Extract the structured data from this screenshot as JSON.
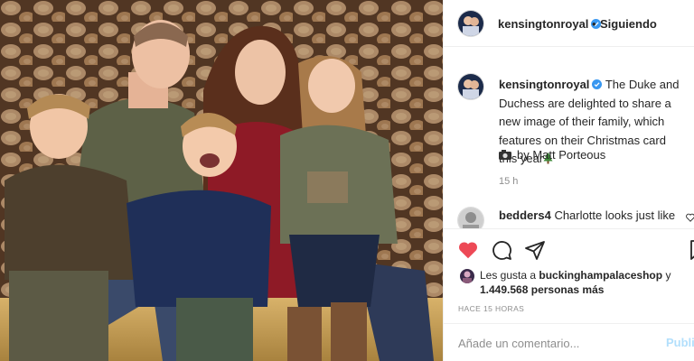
{
  "post": {
    "photo_alt": "",
    "photo": {
      "background": "#6b4a33"
    }
  },
  "header": {
    "username": "kensingtonroyal",
    "separator": "•",
    "follow_label": "Siguiendo"
  },
  "caption": {
    "username": "kensingtonroyal",
    "text": "The Duke and Duchess are delighted to share a new image of their family, which features on their Christmas card this year",
    "credit": "by Matt Porteous",
    "time": "15 h"
  },
  "comment": {
    "username": "bedders4",
    "text": "Charlotte looks just like"
  },
  "actions": {
    "like_icon": "heart-icon",
    "comment_icon": "comment-icon",
    "share_icon": "share-icon",
    "save_icon": "bookmark-icon",
    "like_color": "#ed4956"
  },
  "likes": {
    "prefix": "Les gusta a",
    "user": "buckinghampalaceshop",
    "and": "y",
    "count": "1.449.568",
    "suffix": "personas más"
  },
  "timestamp": "HACE 15 HORAS",
  "comment_box": {
    "placeholder": "Añade un comentario...",
    "publish_label": "Publicar",
    "publish_color": "#b2dffc"
  },
  "colors": {
    "verified": "#3897f0",
    "text": "#262626",
    "muted": "#8e8e8e",
    "border": "#efefef"
  }
}
